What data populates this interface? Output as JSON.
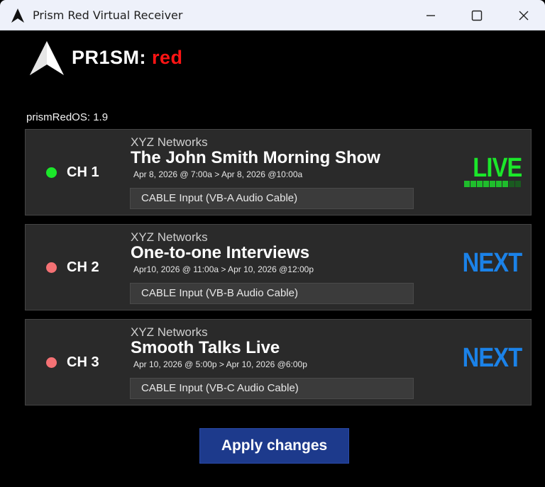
{
  "window": {
    "title": "Prism Red Virtual Receiver"
  },
  "logo": {
    "part1": "PR1SM:",
    "part2": "red"
  },
  "os_version": "prismRedOS: 1.9",
  "colors": {
    "active": "#1be72a",
    "inactive": "#f47174",
    "next": "#1b82e8",
    "brand_red": "#ff1414"
  },
  "channels": [
    {
      "label": "CH 1",
      "network": "XYZ Networks",
      "show": "The John Smith Morning Show",
      "time": "Apr 8, 2026 @ 7:00a > Apr 8, 2026 @10:00a",
      "input": "CABLE Input (VB-A Audio Cable)",
      "status": "LIVE",
      "level": 0.8
    },
    {
      "label": "CH 2",
      "network": "XYZ Networks",
      "show": "One-to-one Interviews",
      "time": "Apr10, 2026 @ 11:00a > Apr 10, 2026 @12:00p",
      "input": "CABLE Input (VB-B Audio Cable)",
      "status": "NEXT"
    },
    {
      "label": "CH 3",
      "network": "XYZ Networks",
      "show": "Smooth Talks Live",
      "time": "Apr 10, 2026 @ 5:00p > Apr 10, 2026 @6:00p",
      "input": "CABLE Input (VB-C Audio Cable)",
      "status": "NEXT"
    }
  ],
  "apply_label": "Apply changes"
}
